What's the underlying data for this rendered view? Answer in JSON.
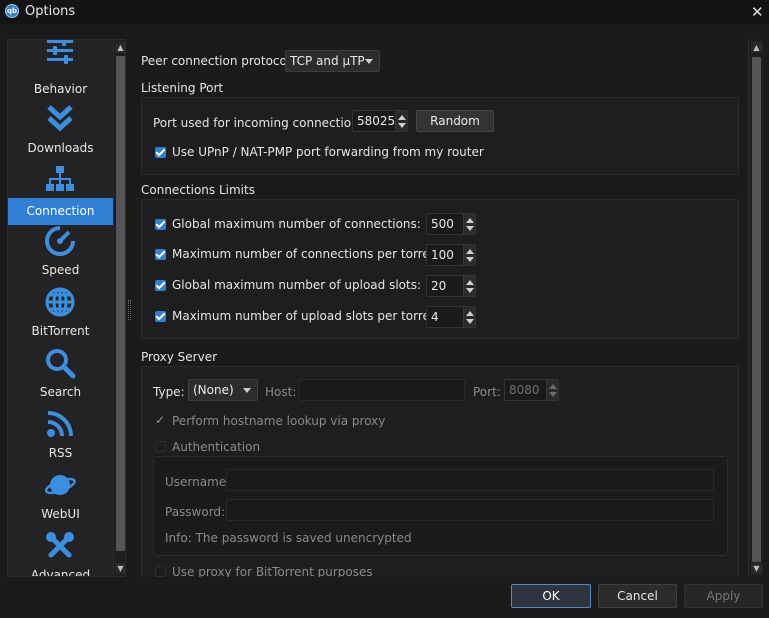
{
  "window": {
    "title": "Options",
    "icon_text": "qb"
  },
  "sidebar": {
    "items": [
      {
        "label": "Behavior",
        "icon": "sliders-icon"
      },
      {
        "label": "Downloads",
        "icon": "double-chevron-down-icon"
      },
      {
        "label": "Connection",
        "icon": "network-icon"
      },
      {
        "label": "Speed",
        "icon": "speedometer-icon"
      },
      {
        "label": "BitTorrent",
        "icon": "globe-icon"
      },
      {
        "label": "Search",
        "icon": "magnifier-icon"
      },
      {
        "label": "RSS",
        "icon": "rss-icon"
      },
      {
        "label": "WebUI",
        "icon": "planet-icon"
      },
      {
        "label": "Advanced",
        "icon": "tools-icon"
      }
    ],
    "active": "Connection"
  },
  "connection": {
    "protocol_label": "Peer connection protocol:",
    "protocol_value": "TCP and µTP",
    "listening": {
      "title": "Listening Port",
      "port_label": "Port used for incoming connections:",
      "port_value": "58025",
      "random_label": "Random",
      "upnp_label": "Use UPnP / NAT-PMP port forwarding from my router"
    },
    "limits": {
      "title": "Connections Limits",
      "rows": [
        {
          "label": "Global maximum number of connections:",
          "value": "500"
        },
        {
          "label": "Maximum number of connections per torrent:",
          "value": "100"
        },
        {
          "label": "Global maximum number of upload slots:",
          "value": "20"
        },
        {
          "label": "Maximum number of upload slots per torrent:",
          "value": "4"
        }
      ]
    },
    "proxy": {
      "title": "Proxy Server",
      "type_label": "Type:",
      "type_value": "(None)",
      "host_label": "Host:",
      "host_value": "",
      "port_label": "Port:",
      "port_value": "8080",
      "hostname_lookup_label": "Perform hostname lookup via proxy",
      "auth_label": "Authentication",
      "username_label": "Username:",
      "password_label": "Password:",
      "info_label": "Info: The password is saved unencrypted",
      "bittorrent_label": "Use proxy for BitTorrent purposes"
    }
  },
  "footer": {
    "ok_label": "OK",
    "cancel_label": "Cancel",
    "apply_label": "Apply"
  },
  "colors": {
    "accent": "#2f7fd4",
    "background": "#1b1b1c"
  }
}
